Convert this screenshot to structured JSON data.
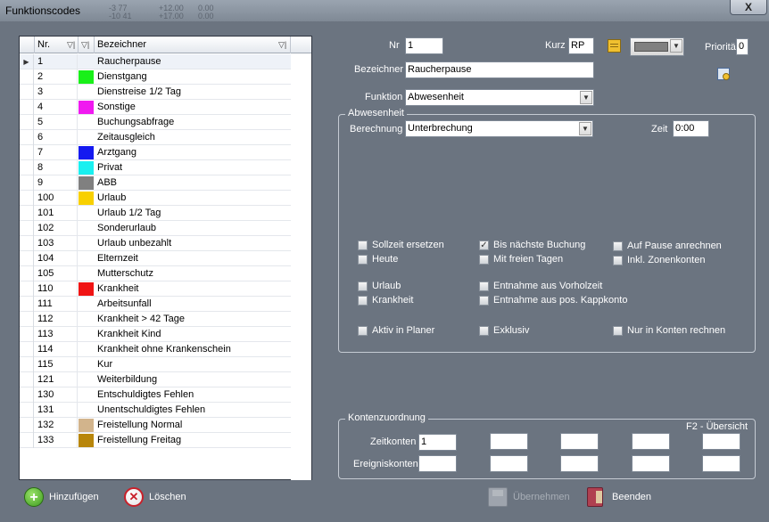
{
  "window": {
    "title": "Funktionscodes",
    "close": "X",
    "ghost_text": [
      "-3 77",
      "+12.00",
      "0.00",
      "-10 41",
      "+17.00",
      "0.00"
    ]
  },
  "grid": {
    "headers": {
      "nr": "Nr.",
      "bez": "Bezeichner"
    },
    "rows": [
      {
        "nr": "1",
        "color": "",
        "label": "Raucherpause",
        "current": true
      },
      {
        "nr": "2",
        "color": "#19f019",
        "label": "Dienstgang"
      },
      {
        "nr": "3",
        "color": "",
        "label": "Dienstreise 1/2 Tag"
      },
      {
        "nr": "4",
        "color": "#f019f0",
        "label": "Sonstige"
      },
      {
        "nr": "5",
        "color": "",
        "label": "Buchungsabfrage"
      },
      {
        "nr": "6",
        "color": "",
        "label": "Zeitausgleich"
      },
      {
        "nr": "7",
        "color": "#1419f0",
        "label": "Arztgang"
      },
      {
        "nr": "8",
        "color": "#19f0f0",
        "label": "Privat"
      },
      {
        "nr": "9",
        "color": "#808080",
        "label": "ABB"
      },
      {
        "nr": "100",
        "color": "#f8d000",
        "label": "Urlaub"
      },
      {
        "nr": "101",
        "color": "",
        "label": "Urlaub 1/2 Tag"
      },
      {
        "nr": "102",
        "color": "",
        "label": "Sonderurlaub"
      },
      {
        "nr": "103",
        "color": "",
        "label": "Urlaub unbezahlt"
      },
      {
        "nr": "104",
        "color": "",
        "label": "Elternzeit"
      },
      {
        "nr": "105",
        "color": "",
        "label": "Mutterschutz"
      },
      {
        "nr": "110",
        "color": "#f01414",
        "label": "Krankheit"
      },
      {
        "nr": "111",
        "color": "",
        "label": "Arbeitsunfall"
      },
      {
        "nr": "112",
        "color": "",
        "label": "Krankheit > 42 Tage"
      },
      {
        "nr": "113",
        "color": "",
        "label": "Krankheit Kind"
      },
      {
        "nr": "114",
        "color": "",
        "label": "Krankheit ohne Krankenschein"
      },
      {
        "nr": "115",
        "color": "",
        "label": "Kur"
      },
      {
        "nr": "121",
        "color": "",
        "label": "Weiterbildung"
      },
      {
        "nr": "130",
        "color": "",
        "label": "Entschuldigtes Fehlen"
      },
      {
        "nr": "131",
        "color": "",
        "label": "Unentschuldigtes Fehlen"
      },
      {
        "nr": "132",
        "color": "#d2b48c",
        "label": "Freistellung Normal"
      },
      {
        "nr": "133",
        "color": "#b8860b",
        "label": "Freistellung Freitag"
      }
    ]
  },
  "form": {
    "nr_label": "Nr",
    "nr_value": "1",
    "kurz_label": "Kurz",
    "kurz_value": "RP",
    "prio_label": "Priorität",
    "prio_value": "0",
    "bez_label": "Bezeichner",
    "bez_value": "Raucherpause",
    "funktion_label": "Funktion",
    "funktion_value": "Abwesenheit",
    "color_swatch": "#808080"
  },
  "abwesenheit": {
    "title": "Abwesenheit",
    "berechnung_label": "Berechnung",
    "berechnung_value": "Unterbrechung",
    "zeit_label": "Zeit",
    "zeit_value": "0:00",
    "checks": {
      "sollzeit": {
        "label": "Sollzeit ersetzen",
        "checked": false
      },
      "heute": {
        "label": "Heute",
        "checked": false
      },
      "urlaub": {
        "label": "Urlaub",
        "checked": false
      },
      "krankheit": {
        "label": "Krankheit",
        "checked": false
      },
      "aktiv": {
        "label": "Aktiv in Planer",
        "checked": false
      },
      "bis_naechste": {
        "label": "Bis nächste Buchung",
        "checked": true
      },
      "freie_tage": {
        "label": "Mit freien Tagen",
        "checked": false
      },
      "vorholzeit": {
        "label": "Entnahme aus Vorholzeit",
        "checked": false
      },
      "kappkonto": {
        "label": "Entnahme aus pos. Kappkonto",
        "checked": false
      },
      "exklusiv": {
        "label": "Exklusiv",
        "checked": false
      },
      "pause": {
        "label": "Auf Pause anrechnen",
        "checked": false
      },
      "zonenkonten": {
        "label": "Inkl. Zonenkonten",
        "checked": false
      },
      "nur_konten": {
        "label": "Nur in Konten rechnen",
        "checked": false
      }
    }
  },
  "konten": {
    "title": "Kontenzuordnung",
    "f2": "F2 - Übersicht",
    "zeitkonten_label": "Zeitkonten",
    "zeitkonten_first": "1",
    "ereignis_label": "Ereigniskonten"
  },
  "buttons": {
    "add": "Hinzufügen",
    "delete": "Löschen",
    "apply": "Übernehmen",
    "exit": "Beenden"
  },
  "icons": {
    "add": "plus-circle-icon",
    "delete": "x-circle-icon",
    "apply": "floppy-disk-icon",
    "exit": "door-exit-icon",
    "note": "sticky-note-icon",
    "settings": "calendar-gear-icon"
  }
}
